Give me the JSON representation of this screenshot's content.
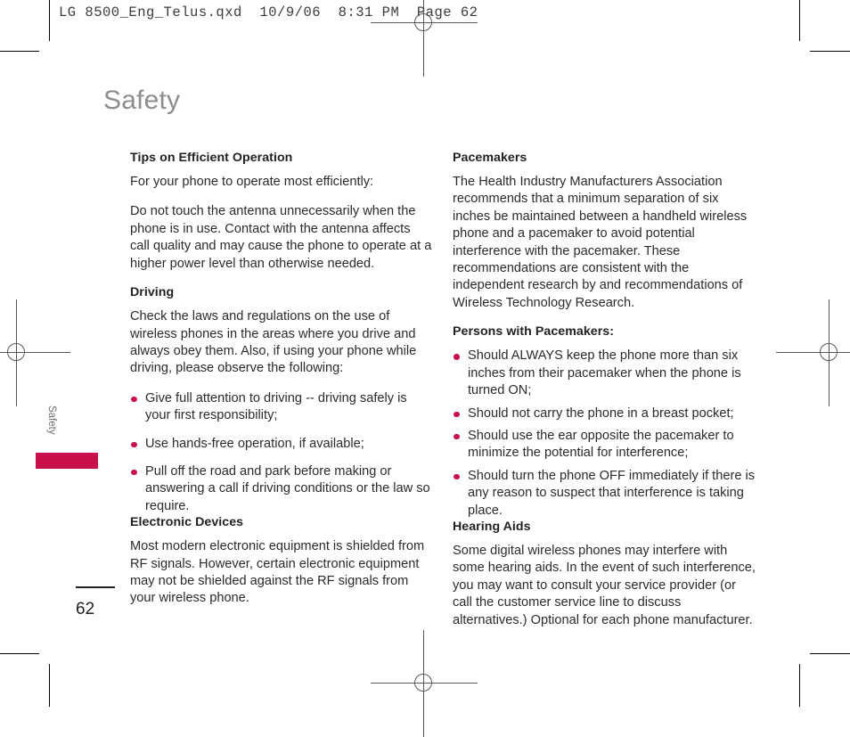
{
  "prepress": {
    "file_header": "LG 8500_Eng_Telus.qxd  10/9/06  8:31 PM  Page 62",
    "registration_mark_name": "registration-target"
  },
  "page": {
    "title": "Safety",
    "side_tab_label": "Safety",
    "folio": "62"
  },
  "colors": {
    "accent": "#c8114b",
    "title_gray": "#8d8d8d",
    "body_text": "#2b2b2b"
  },
  "columns": {
    "left": {
      "sections": [
        {
          "heading": "Tips on Efficient Operation",
          "paragraphs": [
            "For your phone to operate most efficiently:",
            "Do not touch the antenna unnecessarily when the phone is in use. Contact with the antenna affects call quality and may cause the phone to operate at a higher power level than otherwise needed."
          ]
        },
        {
          "heading": "Driving",
          "paragraphs": [
            "Check the laws and regulations on the use of wireless phones in the areas where you drive and always obey them. Also, if using your phone while driving, please observe the following:"
          ],
          "bullets": [
            "Give full attention to driving -- driving safely is your first responsibility;",
            "Use hands-free operation, if available;",
            "Pull off the road and park before making or answering a call if driving conditions or the law so require."
          ]
        },
        {
          "heading": "Electronic Devices",
          "paragraphs": [
            "Most modern electronic equipment is shielded from RF signals. However, certain electronic equipment may not be shielded against the RF signals from your wireless phone."
          ]
        }
      ]
    },
    "right": {
      "sections": [
        {
          "heading": "Pacemakers",
          "paragraphs": [
            "The Health Industry Manufacturers Association recommends that a minimum separation of six inches be maintained between a handheld wireless phone and a pacemaker to avoid potential interference with the pacemaker. These recommendations are consistent with the independent research by and recommendations of Wireless Technology Research."
          ]
        },
        {
          "heading": "Persons with Pacemakers:",
          "bullets": [
            "Should ALWAYS keep the phone more than six inches from their pacemaker when the phone is turned ON;",
            "Should not carry the phone in a breast pocket;",
            "Should use the ear opposite the pacemaker to minimize the potential for interference;",
            "Should turn the phone OFF immediately if there is any reason to suspect that interference is taking place."
          ]
        },
        {
          "heading": "Hearing Aids",
          "paragraphs": [
            "Some digital wireless phones may interfere with some hearing aids. In the event of such interference, you may want to consult your service provider (or call the customer service line to discuss alternatives.) Optional for each phone manufacturer."
          ]
        }
      ]
    }
  }
}
